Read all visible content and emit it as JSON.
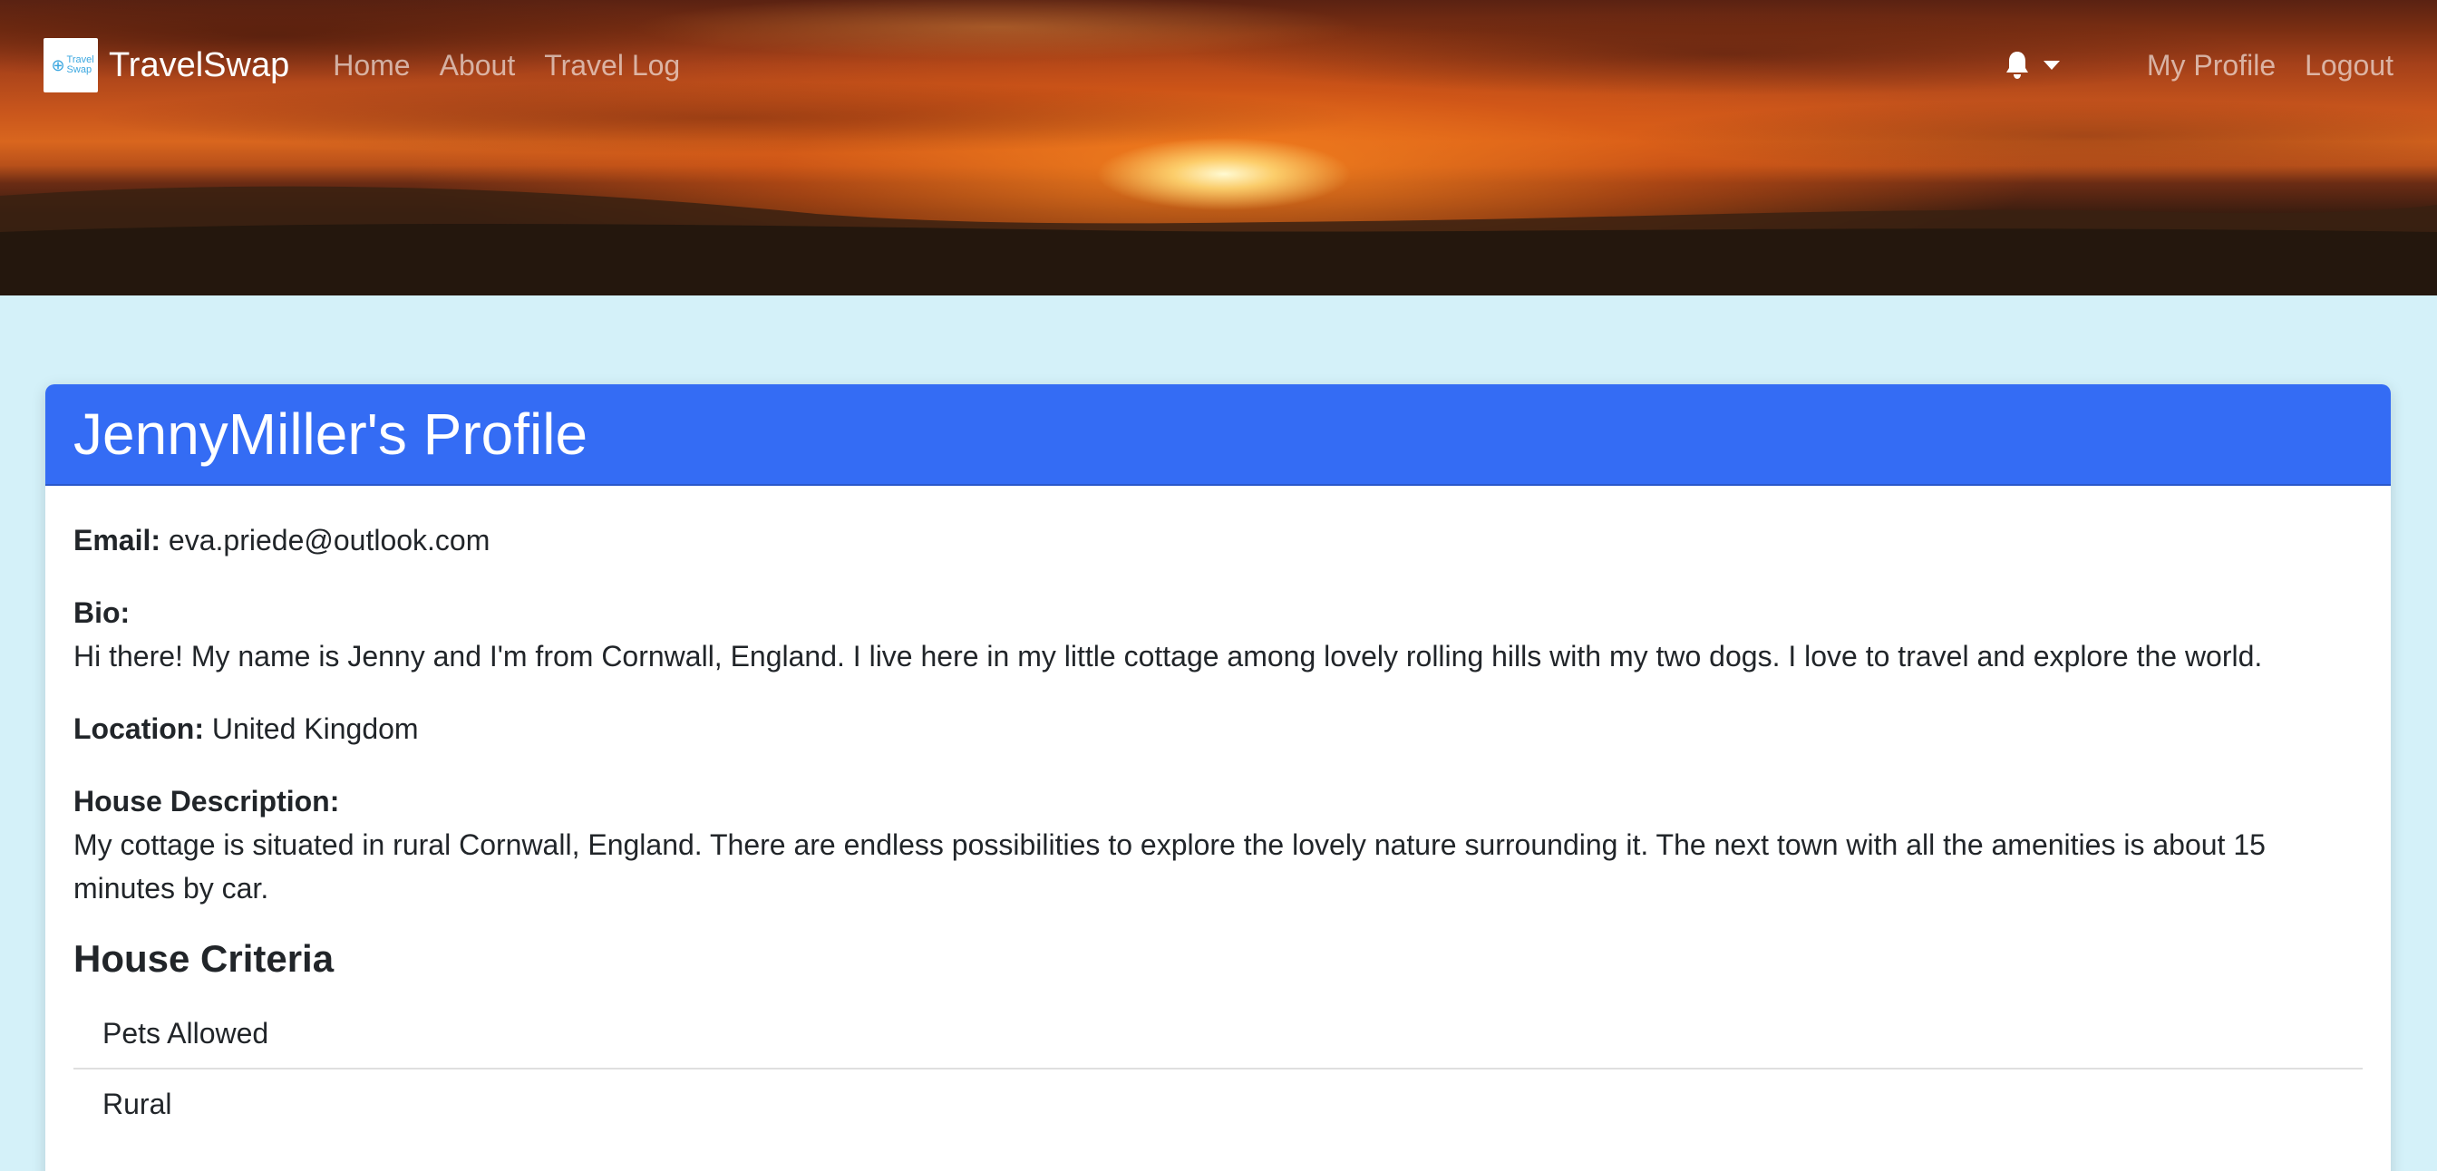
{
  "navbar": {
    "brand": "TravelSwap",
    "logo_text": "Travel Swap",
    "links": [
      "Home",
      "About",
      "Travel Log"
    ],
    "notifications_icon": "bell-icon",
    "right_links": [
      "My Profile",
      "Logout"
    ]
  },
  "profile": {
    "title": "JennyMiller's Profile",
    "email_label": "Email:",
    "email": "eva.priede@outlook.com",
    "bio_label": "Bio:",
    "bio": "Hi there! My name is Jenny and I'm from Cornwall, England. I live here in my little cottage among lovely rolling hills with my two dogs. I love to travel and explore the world.",
    "location_label": "Location:",
    "location": "United Kingdom",
    "house_description_label": "House Description:",
    "house_description": "My cottage is situated in rural Cornwall, England. There are endless possibilities to explore the lovely nature surrounding it. The next town with all the amenities is about 15 minutes by car.",
    "criteria_title": "House Criteria",
    "criteria": [
      "Pets Allowed",
      "Rural"
    ]
  },
  "colors": {
    "page_bg": "#d4f1f9",
    "card_header": "#346cf4"
  }
}
